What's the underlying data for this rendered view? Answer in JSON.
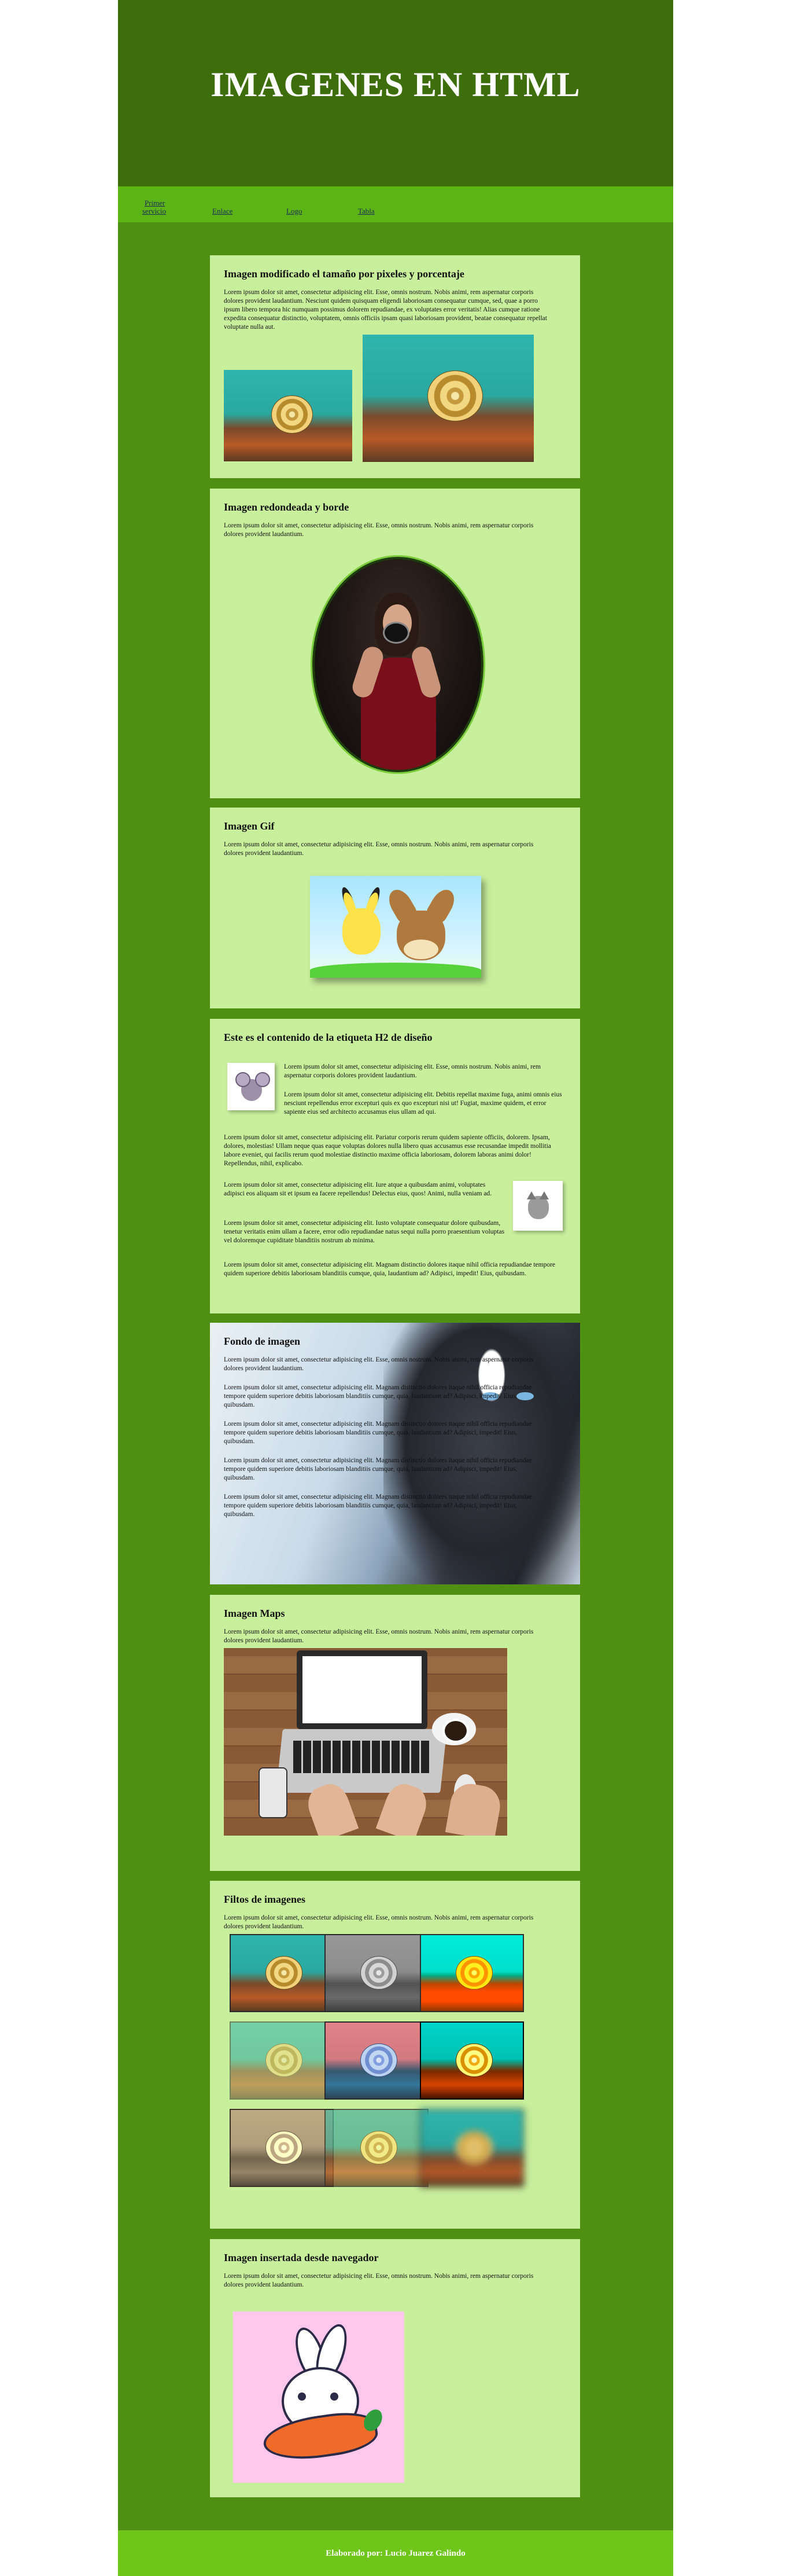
{
  "page_title": "IMAGENES EN HTML",
  "nav": [
    {
      "label_line1": "Primer",
      "label_line2": "servicio"
    },
    {
      "label": "Enlace"
    },
    {
      "label": "Logo"
    },
    {
      "label": "Tabla"
    }
  ],
  "sections": {
    "size": {
      "title": "Imagen modificado el tamaño por pixeles y porcentaje",
      "text": "Lorem ipsum dolor sit amet, consectetur adipisicing elit. Esse, omnis nostrum. Nobis animi, rem aspernatur corporis dolores provident laudantium. Nesciunt quidem quisquam eligendi laboriosam consequatur cumque, sed, quae a porro ipsum libero tempora hic numquam possimus dolorem repudiandae, ex voluptates error veritatis! Alias cumque ratione expedita consequatur distinctio, voluptatem, omnis officiis ipsam quasi laboriosam provident, beatae consequatur repellat voluptate nulla aut."
    },
    "rounded": {
      "title": "Imagen redondeada y borde",
      "text": "Lorem ipsum dolor sit amet, consectetur adipisicing elit. Esse, omnis nostrum. Nobis animi, rem aspernatur corporis dolores provident laudantium."
    },
    "gif": {
      "title": "Imagen Gif",
      "text": "Lorem ipsum dolor sit amet, consectetur adipisicing elit. Esse, omnis nostrum. Nobis animi, rem aspernatur corporis dolores provident laudantium."
    },
    "h2": {
      "title": "Este es el contenido de la etiqueta H2 de diseño",
      "p1": "Lorem ipsum dolor sit amet, consectetur adipisicing elit. Esse, omnis nostrum. Nobis animi, rem aspernatur corporis dolores provident laudantium.",
      "p2": "Lorem ipsum dolor sit amet, consectetur adipisicing elit. Debitis repellat maxime fuga, animi omnis eius nesciunt repellendus error excepturi quis ex quo excepturi nisi ut! Fugiat, maxime quidem, et error sapiente eius sed architecto accusamus eius ullam ad qui.",
      "p3": "Lorem ipsum dolor sit amet, consectetur adipisicing elit. Pariatur corporis rerum quidem sapiente officiis, dolorem. Ipsam, dolores, molestias! Ullam neque quas eaque voluptas dolores nulla libero quas accusamus esse recusandae impedit mollitia labore eveniet, qui facilis rerum quod molestiae distinctio maxime officia laboriosam, dolorem laboras animi dolor! Repellendus, nihil, explicabo.",
      "p4": "Lorem ipsum dolor sit amet, consectetur adipisicing elit. Iure atque a quibusdam animi, voluptates adipisci eos aliquam sit et ipsum ea facere repellendus! Delectus eius, quos! Animi, nulla veniam ad.",
      "p5": "Lorem ipsum dolor sit amet, consectetur adipisicing elit. Iusto voluptate consequatur dolore quibusdam, tenetur veritatis enim ullam a facere, error odio repudiandae natus sequi nulla porro praesentium voluptas vel doloremque cupiditate blanditiis nostrum ab minima.",
      "p6": "Lorem ipsum dolor sit amet, consectetur adipisicing elit. Magnam distinctio dolores itaque nihil officia repudiandae tempore quidem superiore debitis laboriosam blanditiis cumque, quia, laudantium ad? Adipisci, impedit! Eius, quibusdam."
    },
    "background": {
      "title": "Fondo de imagen",
      "p1": "Lorem ipsum dolor sit amet, consectetur adipisicing elit. Esse, omnis nostrum. Nobis animi, rem aspernatur corporis dolores provident laudantium.",
      "p2": "Lorem ipsum dolor sit amet, consectetur adipisicing elit. Magnam distinctio dolores itaque nihil officia repudiandae tempore quidem superiore debitis laboriosam blanditiis cumque, quia, laudantium ad? Adipisci, impedit! Eius, quibusdam.",
      "p3": "Lorem ipsum dolor sit amet, consectetur adipisicing elit. Magnam distinctio dolores itaque nihil officia repudiandae tempore quidem superiore debitis laboriosam blanditiis cumque, quia, laudantium ad? Adipisci, impedit! Eius, quibusdam.",
      "p4": "Lorem ipsum dolor sit amet, consectetur adipisicing elit. Magnam distinctio dolores itaque nihil officia repudiandae tempore quidem superiore debitis laboriosam blanditiis cumque, quia, laudantium ad? Adipisci, impedit! Eius, quibusdam.",
      "p5": "Lorem ipsum dolor sit amet, consectetur adipisicing elit. Magnam distinctio dolores itaque nihil officia repudiandae tempore quidem superiore debitis laboriosam blanditiis cumque, quia, laudantium ad? Adipisci, impedit! Eius, quibusdam."
    },
    "maps": {
      "title": "Imagen Maps",
      "text": "Lorem ipsum dolor sit amet, consectetur adipisicing elit. Esse, omnis nostrum. Nobis animi, rem aspernatur corporis dolores provident laudantium."
    },
    "filters": {
      "title": "Filtos de imagenes",
      "text": "Lorem ipsum dolor sit amet, consectetur adipisicing elit. Esse, omnis nostrum. Nobis animi, rem aspernatur corporis dolores provident laudantium."
    },
    "browser": {
      "title": "Imagen insertada desde navegador",
      "text": "Lorem ipsum dolor sit amet, consectetur adipisicing elit. Esse, omnis nostrum. Nobis animi, rem aspernatur corporis dolores provident laudantium."
    }
  },
  "footer": "Elaborado por: Lucio Juarez Galindo",
  "colors": {
    "page_bg": "#4f8f12",
    "header_bg": "#3e6e0c",
    "nav_bg": "#5cb514",
    "card_bg": "#c8ef9c",
    "footer_bg": "#6fc51a"
  }
}
